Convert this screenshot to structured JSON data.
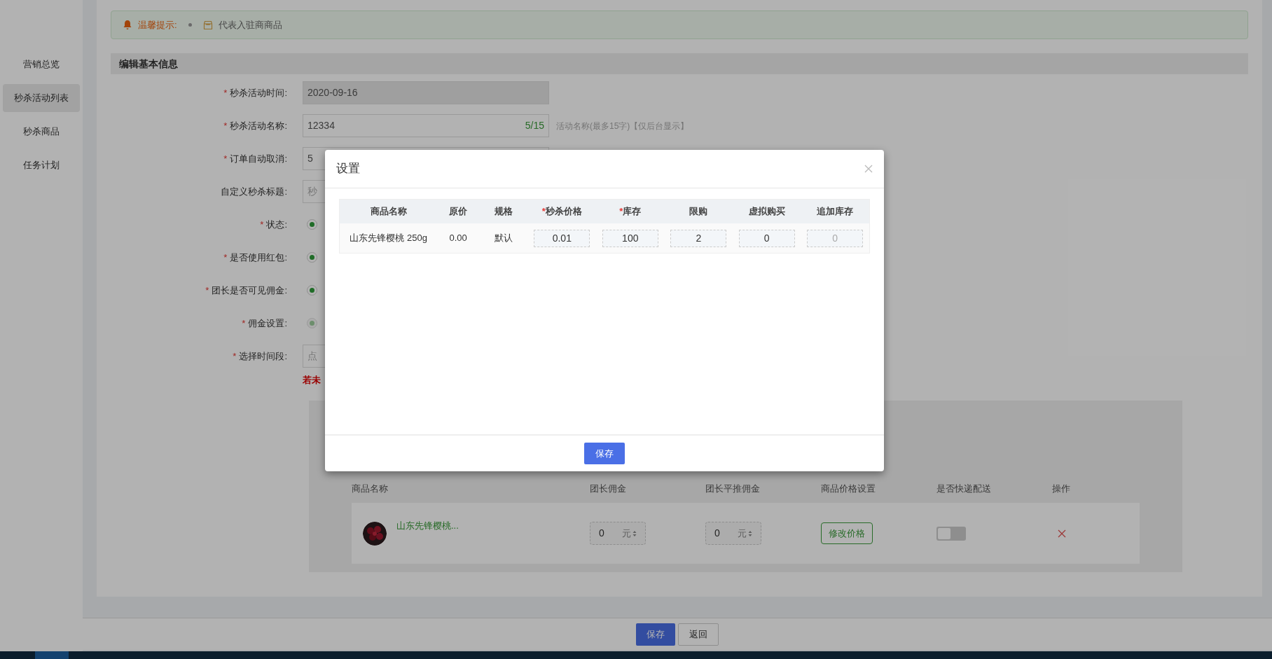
{
  "sidebar": {
    "items": [
      {
        "label": "营销总览",
        "selected": false
      },
      {
        "label": "秒杀活动列表",
        "selected": true
      },
      {
        "label": "秒杀商品",
        "selected": false
      },
      {
        "label": "任务计划",
        "selected": false
      }
    ]
  },
  "notice": {
    "title": "温馨提示:",
    "text": "代表入驻商商品"
  },
  "section_title": "编辑基本信息",
  "form": {
    "rows": [
      {
        "kind": "input",
        "required_mark": "*",
        "label": "秒杀活动时间:",
        "value": "2020-09-16",
        "disabled": true
      },
      {
        "kind": "input",
        "required_mark": "*",
        "label": "秒杀活动名称:",
        "value": "12334",
        "counter": "5/15",
        "hint": "活动名称(最多15字)【仅后台显示】",
        "disabled": false
      },
      {
        "kind": "input",
        "required_mark": "*",
        "label": "订单自动取消:",
        "value": "5",
        "disabled": false
      },
      {
        "kind": "input",
        "label": "自定义秒杀标题:",
        "placeholder": "秒",
        "disabled": false
      },
      {
        "kind": "radio",
        "required_mark": "*",
        "label": "状态:",
        "checked": true,
        "disabled": false
      },
      {
        "kind": "radio",
        "required_mark": "*",
        "label": "是否使用红包:",
        "checked": true,
        "disabled": false
      },
      {
        "kind": "radio",
        "required_mark": "*",
        "label": "团长是否可见佣金:",
        "checked": true,
        "disabled": false
      },
      {
        "kind": "radio",
        "required_mark": "*",
        "label": "佣金设置:",
        "checked": true,
        "disabled": true
      },
      {
        "kind": "input",
        "required_mark": "*",
        "label": "选择时间段:",
        "placeholder": "点",
        "disabled": false
      }
    ],
    "warning": "若未"
  },
  "products": {
    "columns": [
      "商品名称",
      "团长佣金",
      "团长平推佣金",
      "商品价格设置",
      "是否快递配送",
      "操作"
    ],
    "rows": [
      {
        "name": "山东先锋樱桃...",
        "commission": "0",
        "commission_unit": "元",
        "flat_commission": "0",
        "flat_unit": "元",
        "price_button": "修改价格",
        "express": false
      }
    ]
  },
  "footer": {
    "buttons": [
      {
        "label": "保存",
        "primary": true
      },
      {
        "label": "返回",
        "primary": false
      }
    ]
  },
  "modal": {
    "title": "设置",
    "columns": [
      {
        "label": "商品名称"
      },
      {
        "label": "原价"
      },
      {
        "label": "规格"
      },
      {
        "label": "秒杀价格",
        "required_mark": "*"
      },
      {
        "label": "库存",
        "required_mark": "*"
      },
      {
        "label": "限购"
      },
      {
        "label": "虚拟购买"
      },
      {
        "label": "追加库存"
      }
    ],
    "rows": [
      {
        "name": "山东先锋樱桃 250g",
        "price": "0.00",
        "spec": "默认",
        "inputs": [
          {
            "value": "0.01",
            "disabled": false
          },
          {
            "value": "100",
            "disabled": false
          },
          {
            "value": "2",
            "disabled": false
          },
          {
            "value": "0",
            "disabled": false
          },
          {
            "value": "0",
            "disabled": true
          }
        ]
      }
    ],
    "save": "保存"
  }
}
